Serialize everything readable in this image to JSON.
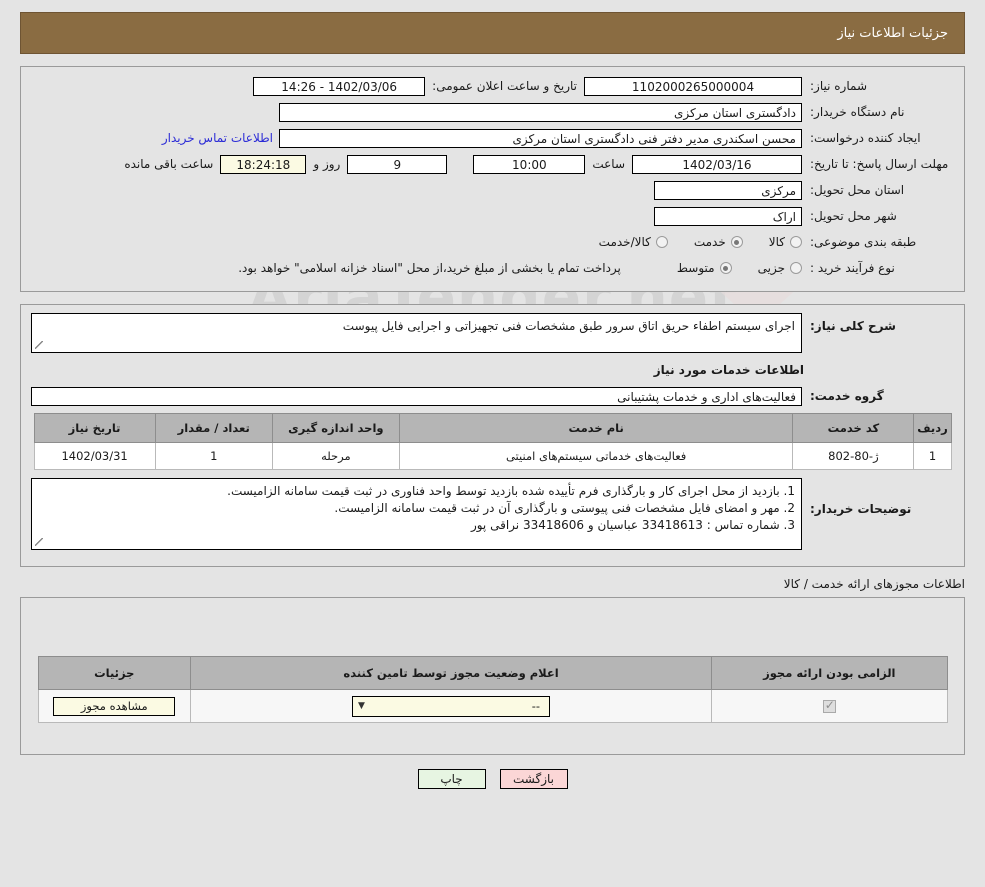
{
  "header": {
    "title": "جزئیات اطلاعات نیاز"
  },
  "info": {
    "need_number_label": "شماره نیاز:",
    "need_number_value": "1102000265000004",
    "public_announce_label": "تاریخ و ساعت اعلان عمومی:",
    "public_announce_value": "1402/03/06 - 14:26",
    "buyer_org_label": "نام دستگاه خریدار:",
    "buyer_org_value": "دادگستری استان مرکزی",
    "creator_label": "ایجاد کننده درخواست:",
    "creator_value": "محسن اسکندری مدیر دفتر فنی دادگستری استان مرکزی",
    "contact_link": "اطلاعات تماس خریدار",
    "deadline_label": "مهلت ارسال پاسخ: تا تاریخ:",
    "deadline_date": "1402/03/16",
    "hour_label": "ساعت",
    "hour_value": "10:00",
    "days_value": "9",
    "days_label": "روز و",
    "countdown_value": "18:24:18",
    "countdown_label": "ساعت باقی مانده",
    "province_label": "استان محل تحویل:",
    "province_value": "مرکزی",
    "city_label": "شهر محل تحویل:",
    "city_value": "اراک",
    "category_label": "طبقه بندی موضوعی:",
    "category_options": [
      {
        "label": "کالا",
        "selected": false
      },
      {
        "label": "خدمت",
        "selected": true
      },
      {
        "label": "کالا/خدمت",
        "selected": false
      }
    ],
    "process_label": "نوع فرآیند خرید :",
    "process_options": [
      {
        "label": "جزیی",
        "selected": false
      },
      {
        "label": "متوسط",
        "selected": true
      }
    ],
    "process_note": "پرداخت تمام یا بخشی از مبلغ خرید،از محل \"اسناد خزانه اسلامی\" خواهد بود."
  },
  "description": {
    "general_label": "شرح کلی نیاز:",
    "general_value": "اجرای سیستم اطفاء حریق اتاق سرور طبق مشخصات فنی تجهیزاتی و اجرایی فایل پیوست",
    "section_title": "اطلاعات خدمات مورد نیاز",
    "service_group_label": "گروه خدمت:",
    "service_group_value": "فعالیت‌های اداری و خدمات پشتیبانی"
  },
  "items_table": {
    "headers": [
      "ردیف",
      "کد خدمت",
      "نام خدمت",
      "واحد اندازه گیری",
      "تعداد / مقدار",
      "تاریخ نیاز"
    ],
    "rows": [
      {
        "row": "1",
        "code": "ژ-80-802",
        "name": "فعالیت‌های خدماتی سیستم‌های امنیتی",
        "unit": "مرحله",
        "qty": "1",
        "date": "1402/03/31"
      }
    ]
  },
  "buyer_notes": {
    "label": "توضیحات خریدار:",
    "lines": [
      "1. بازدید از محل اجرای کار و بارگذاری فرم تأییده شده بازدید توسط واحد فناوری در ثبت قیمت سامانه الزامیست.",
      "2. مهر و امضای فایل مشخصات فنی پیوستی و بارگذاری آن در ثبت قیمت سامانه الزامیست.",
      "3. شماره تماس : 33418613 عباسیان و 33418606 نراقی پور"
    ]
  },
  "permits": {
    "section_label": "اطلاعات مجوزهای ارائه خدمت / کالا",
    "headers": [
      "الزامی بودن ارائه مجوز",
      "اعلام وضعیت مجوز توسط تامین کننده",
      "جزئیات"
    ],
    "rows": [
      {
        "required_checked": true,
        "status_value": "--",
        "details_button": "مشاهده مجوز"
      }
    ]
  },
  "footer": {
    "back_label": "بازگشت",
    "print_label": "چاپ"
  },
  "watermark": {
    "text": "AriaTender.net"
  },
  "colors": {
    "header_bar": "#8a6c42",
    "page_bg": "#e4e4e4",
    "link": "#2b2bd6",
    "back_button": "#fbd6d6",
    "print_button": "#e7f5e2",
    "highlight_field": "#fbfae3"
  }
}
